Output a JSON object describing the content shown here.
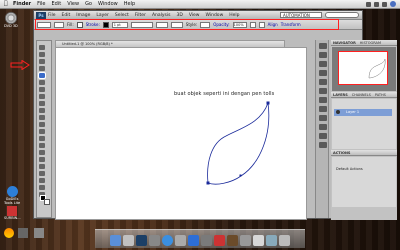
{
  "menubar": {
    "items": [
      "Finder",
      "File",
      "Edit",
      "View",
      "Go",
      "Window",
      "Help"
    ]
  },
  "desktop_icons_left": [
    {
      "label": "DVD 3D"
    }
  ],
  "desktop_icons_bottom_left": [
    {
      "label": "GoDIEs\nTools Lite"
    },
    {
      "label": "SURBIN..."
    },
    {
      "label": "..."
    }
  ],
  "photoshop": {
    "logo": "Ps",
    "menus": [
      "File",
      "Edit",
      "Image",
      "Layer",
      "Select",
      "Filter",
      "Analysis",
      "3D",
      "View",
      "Window",
      "Help"
    ],
    "workspace": "AUTOMATION",
    "options": {
      "fill_label": "Fill:",
      "stroke_label": "Stroke:",
      "stroke_width": "1 pt",
      "style_label": "Style:",
      "opacity_label": "Opacity:",
      "opacity_value": "100%",
      "align_label": "Align",
      "transform_label": "Transform"
    },
    "document_tab": "Untitled-1 @ 100% (RGB/8) *",
    "canvas_text": "buat objek seperti ini dengan pen tolls",
    "panels": {
      "navigator_tabs": [
        "NAVIGATOR",
        "HISTOGRAM"
      ],
      "layers_tabs": [
        "LAYERS",
        "CHANNELS",
        "PATHS"
      ],
      "layer_name": "Layer 1",
      "actions_tabs": [
        "ACTIONS"
      ],
      "actions_row1": "Default Actions",
      "actions_row2": ""
    }
  },
  "dock": {
    "app_count": 14
  }
}
